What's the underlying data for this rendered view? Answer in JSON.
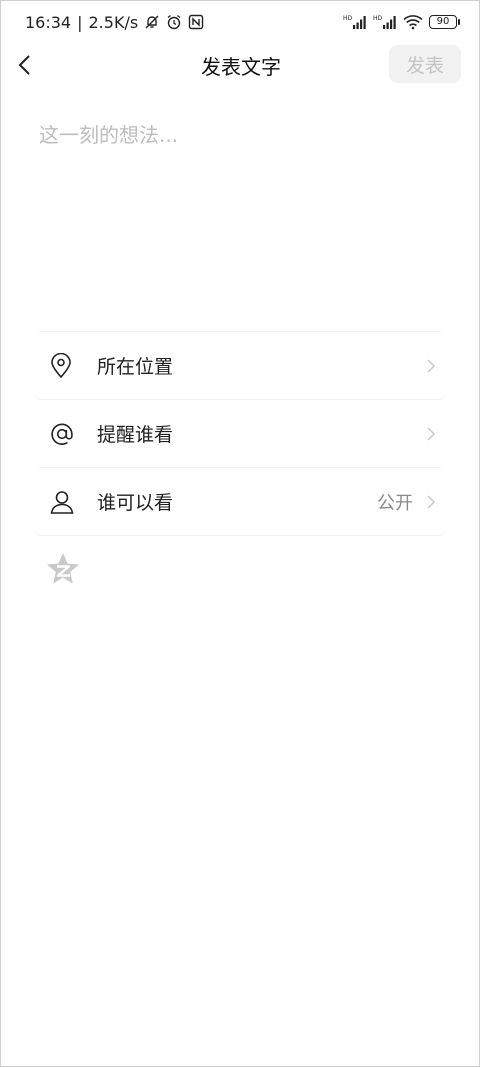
{
  "status_bar": {
    "time": "16:34",
    "net_speed": "2.5K/s",
    "battery": "90",
    "signal_label_1": "HD",
    "signal_label_2": "HD"
  },
  "header": {
    "title": "发表文字",
    "publish_label": "发表"
  },
  "editor": {
    "placeholder": "这一刻的想法...",
    "value": ""
  },
  "options": {
    "location_label": "所在位置",
    "mention_label": "提醒谁看",
    "visibility_label": "谁可以看",
    "visibility_value": "公开"
  },
  "colors": {
    "publish_disabled_bg": "#f2f2f2",
    "publish_disabled_text": "#c4c4c4",
    "placeholder": "#bdbdbd",
    "divider": "#f0f0f0"
  }
}
